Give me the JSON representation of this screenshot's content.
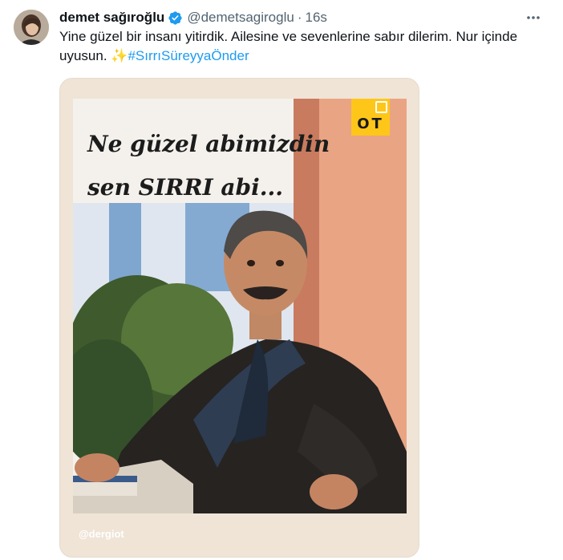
{
  "tweet": {
    "author_name": "demet sağıroğlu",
    "handle": "@demetsagiroglu",
    "separator": "·",
    "time": "16s",
    "text_main": "Yine güzel bir insanı yitirdik. Ailesine ve sevenlerine sabır dilerim. Nur içinde uyusun. ",
    "sparkle": "✨",
    "hashtag": "#SırrıSüreyyaÖnder"
  },
  "media": {
    "caption_line1": "Ne güzel abimizdin",
    "caption_line2": "sen SIRRI abi...",
    "logo_text": "OT",
    "watermark": "@dergiot"
  },
  "colors": {
    "link": "#1d9bf0",
    "verified": "#1d9bf0",
    "card_bg": "#efe4d6",
    "logo_bg": "#ffc61a"
  },
  "icons": [
    "verified-badge-icon",
    "more-options-icon"
  ]
}
